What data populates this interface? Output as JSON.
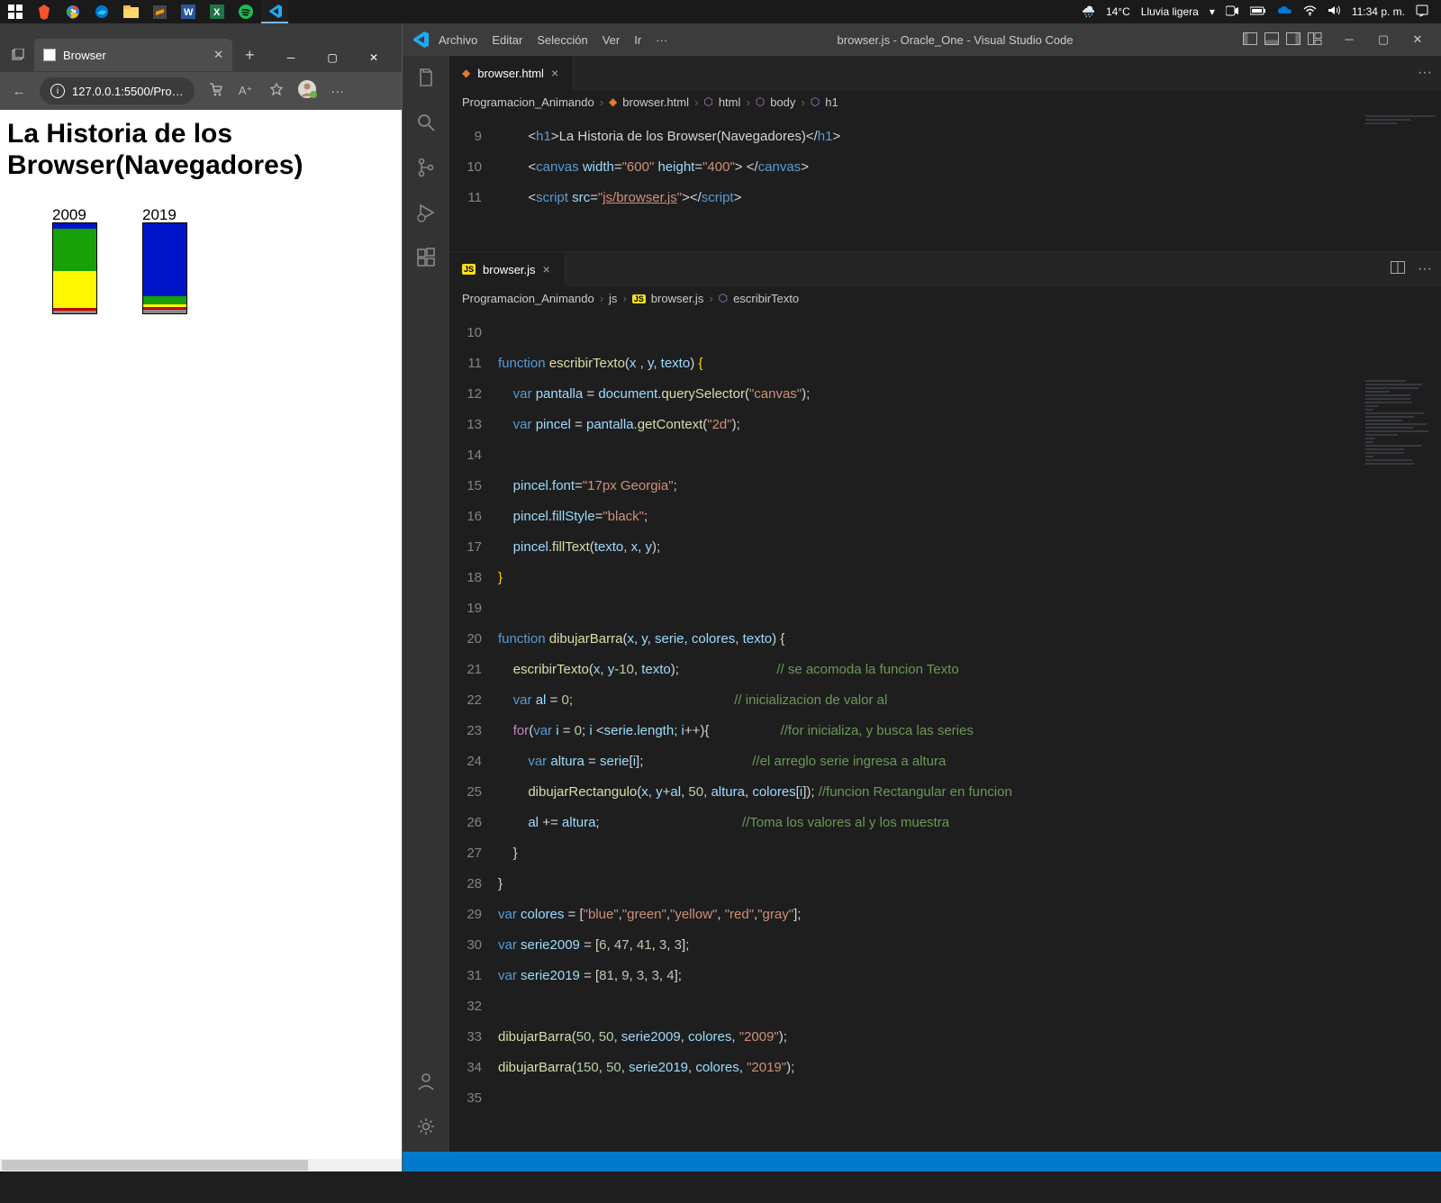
{
  "taskbar": {
    "weather_temp": "14°C",
    "weather_text": "Lluvia ligera",
    "time": "11:34 p. m."
  },
  "browser": {
    "tab_title": "Browser",
    "url": "127.0.0.1:5500/Pro…",
    "page_h1_line1": "La Historia de los",
    "page_h1_line2": "Browser(Navegadores)"
  },
  "chart_data": [
    {
      "type": "bar-stacked",
      "label": "2009",
      "x": 50,
      "series": [
        {
          "name": "blue",
          "value": 6,
          "color": "#0014c7"
        },
        {
          "name": "green",
          "value": 47,
          "color": "#17a008"
        },
        {
          "name": "yellow",
          "value": 41,
          "color": "#fff700"
        },
        {
          "name": "red",
          "value": 3,
          "color": "#c40000"
        },
        {
          "name": "gray",
          "value": 3,
          "color": "#8a8a8a"
        }
      ]
    },
    {
      "type": "bar-stacked",
      "label": "2019",
      "x": 150,
      "series": [
        {
          "name": "blue",
          "value": 81,
          "color": "#0014c7"
        },
        {
          "name": "green",
          "value": 9,
          "color": "#17a008"
        },
        {
          "name": "yellow",
          "value": 3,
          "color": "#fff700"
        },
        {
          "name": "red",
          "value": 3,
          "color": "#c40000"
        },
        {
          "name": "gray",
          "value": 4,
          "color": "#8a8a8a"
        }
      ]
    }
  ],
  "vscode": {
    "menu": [
      "Archivo",
      "Editar",
      "Selección",
      "Ver",
      "Ir",
      "···"
    ],
    "title": "browser.js - Oracle_One - Visual Studio Code",
    "tab1": "browser.html",
    "tab2": "browser.js",
    "crumbs_top": [
      "Programacion_Animando",
      "browser.html",
      "html",
      "body",
      "h1"
    ],
    "crumbs_bot": [
      "Programacion_Animando",
      "js",
      "browser.js",
      "escribirTexto"
    ],
    "top_lines": [
      {
        "n": "9"
      },
      {
        "n": "10"
      },
      {
        "n": "11"
      }
    ],
    "bot_lines": [
      {
        "n": "10"
      },
      {
        "n": "11"
      },
      {
        "n": "12"
      },
      {
        "n": "13"
      },
      {
        "n": "14"
      },
      {
        "n": "15"
      },
      {
        "n": "16"
      },
      {
        "n": "17"
      },
      {
        "n": "18"
      },
      {
        "n": "19"
      },
      {
        "n": "20"
      },
      {
        "n": "21"
      },
      {
        "n": "22"
      },
      {
        "n": "23"
      },
      {
        "n": "24"
      },
      {
        "n": "25"
      },
      {
        "n": "26"
      },
      {
        "n": "27"
      },
      {
        "n": "28"
      },
      {
        "n": "29"
      },
      {
        "n": "30"
      },
      {
        "n": "31"
      },
      {
        "n": "32"
      },
      {
        "n": "33"
      },
      {
        "n": "34"
      },
      {
        "n": "35"
      }
    ]
  }
}
